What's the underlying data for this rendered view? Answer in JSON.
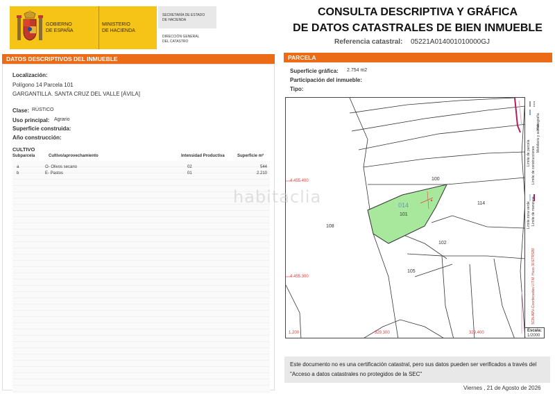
{
  "header": {
    "gov_line1": "GOBIERNO",
    "gov_line2": "DE ESPAÑA",
    "ministry_line1": "MINISTERIO",
    "ministry_line2": "DE HACIENDA",
    "sec_line1": "SECRETARÍA DE ESTADO",
    "sec_line2": "DE HACIENDA",
    "dir_line1": "DIRECCIÓN GENERAL",
    "dir_line2": "DEL CATASTRO",
    "title_line1": "CONSULTA DESCRIPTIVA Y GRÁFICA",
    "title_line2": "DE DATOS CATASTRALES DE BIEN INMUEBLE",
    "ref_label": "Referencia catastral:",
    "ref_value": "05221A014001010000GJ"
  },
  "descriptive": {
    "section_title": "DATOS DESCRIPTIVOS DEL INMUEBLE",
    "localizacion_label": "Localización:",
    "localizacion_line1": "Polígono 14 Parcela 101",
    "localizacion_line2": "GARGANTILLA. SANTA CRUZ DEL VALLE [ÁVILA]",
    "clase_label": "Clase:",
    "clase_value": "RÚSTICO",
    "uso_label": "Uso principal:",
    "uso_value": "Agrario",
    "superficie_label": "Superficie construida:",
    "anio_label": "Año construcción:",
    "cultivo_title": "CULTIVO",
    "table_headers": [
      "Subparcela",
      "Cultivo/aprovechamiento",
      "Intensidad Productiva",
      "Superficie m²"
    ],
    "rows": [
      {
        "sub": "a",
        "cultivo": "O- Olivos secano",
        "intensidad": "02",
        "superficie": "544"
      },
      {
        "sub": "b",
        "cultivo": "E- Pastos",
        "intensidad": "01",
        "superficie": "2.210"
      }
    ]
  },
  "parcela": {
    "section_title": "PARCELA",
    "superficie_label": "Superficie gráfica:",
    "superficie_value": "2.754 m2",
    "participacion_label": "Participación del inmueble:",
    "tipo_label": "Tipo:",
    "map": {
      "parcel_numbers": [
        "100",
        "114",
        "108",
        "101",
        "102",
        "105"
      ],
      "highlight_label": "014",
      "coord_left_top": "4.455.400",
      "coord_left_bottom": "4.455.300",
      "coord_bottom_left": "1.200",
      "coord_bottom_mid": "329.300",
      "coord_bottom_right": "329.400",
      "highlight_color": "#a8e89c"
    },
    "legend": {
      "item1": "Límite de parcela",
      "item2": "Límite de construcciones",
      "item3": "Mobiliario y aceras",
      "item4": "Límite zona verde",
      "item5": "Hidrografía",
      "item6": "Límite de manzana",
      "crs": "SCN-ARV-Coordenadas U.T.M. Huso 30 ETRS89",
      "scale_label": "Escala:",
      "scale_value": "1/2000"
    }
  },
  "footer": {
    "note": "Este documento no es una certificación catastral, pero sus datos pueden ser verificados a través del \"Acceso a datos catastrales no protegidos de la SEC\"",
    "date": "Viernes , 21 de Agosto de 2026"
  },
  "watermark": "habitaclia"
}
